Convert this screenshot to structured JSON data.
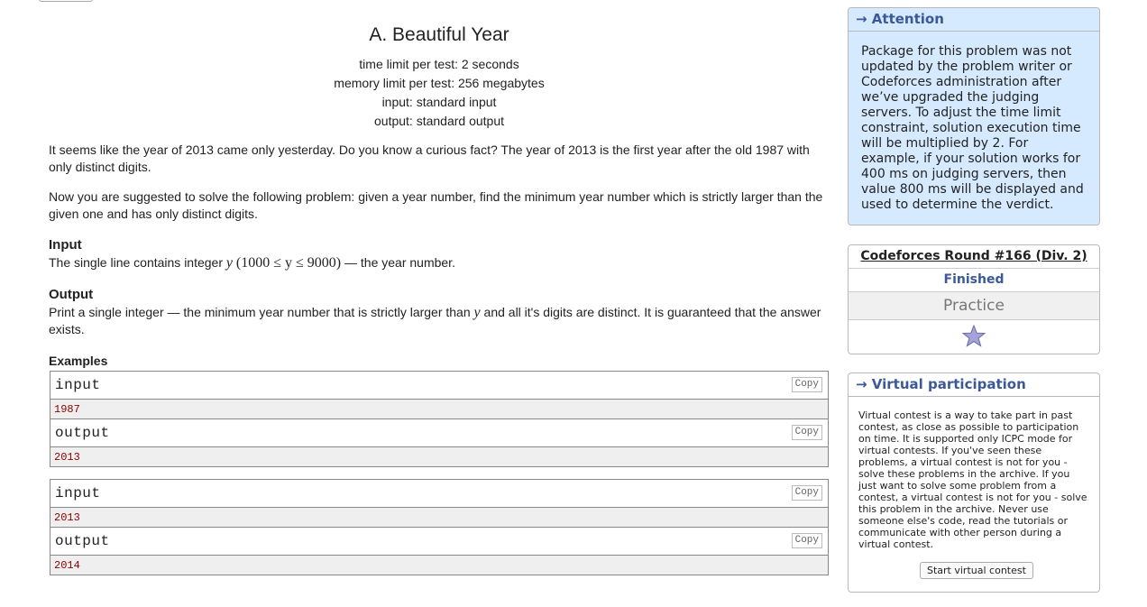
{
  "problem": {
    "title": "A. Beautiful Year",
    "limits": [
      "time limit per test: 2 seconds",
      "memory limit per test: 256 megabytes",
      "input: standard input",
      "output: standard output"
    ],
    "paragraph1": "It seems like the year of 2013 came only yesterday. Do you know a curious fact? The year of 2013 is the first year after the old 1987 with only distinct digits.",
    "paragraph2": "Now you are suggested to solve the following problem: given a year number, find the minimum year number which is strictly larger than the given one and has only distinct digits.",
    "input_title": "Input",
    "input_text_before": "The single line contains integer ",
    "input_var": "y",
    "input_range": "(1000 ≤ y ≤ 9000)",
    "input_text_after": " — the year number.",
    "output_title": "Output",
    "output_text_before": "Print a single integer — the minimum year number that is strictly larger than ",
    "output_var": "y",
    "output_text_after": " and all it's digits are distinct. It is guaranteed that the answer exists.",
    "examples_title": "Examples",
    "input_label": "input",
    "output_label": "output",
    "copy_label": "Copy",
    "examples": [
      {
        "input": "1987",
        "output": "2013"
      },
      {
        "input": "2013",
        "output": "2014"
      }
    ]
  },
  "sidebar": {
    "attention": {
      "title": "→ Attention",
      "text": "Package for this problem was not updated by the problem writer or Codeforces administration after we’ve upgraded the judging servers. To adjust the time limit constraint, solution execution time will be multiplied by 2. For example, if your solution works for 400 ms on judging servers, then value 800 ms will be displayed and used to determine the verdict."
    },
    "contest": {
      "name": "Codeforces Round #166 (Div. 2)",
      "status": "Finished",
      "phase": "Practice",
      "star_icon": "star-icon",
      "star_color": "#9c9ccf"
    },
    "virtual": {
      "title": "→ Virtual participation",
      "text": "Virtual contest is a way to take part in past contest, as close as possible to participation on time. It is supported only ICPC mode for virtual contests. If you've seen these problems, a virtual contest is not for you - solve these problems in the archive. If you just want to solve some problem from a contest, a virtual contest is not for you - solve this problem in the archive. Never use someone else's code, read the tutorials or communicate with other person during a virtual contest.",
      "button_label": "Start virtual contest"
    }
  }
}
